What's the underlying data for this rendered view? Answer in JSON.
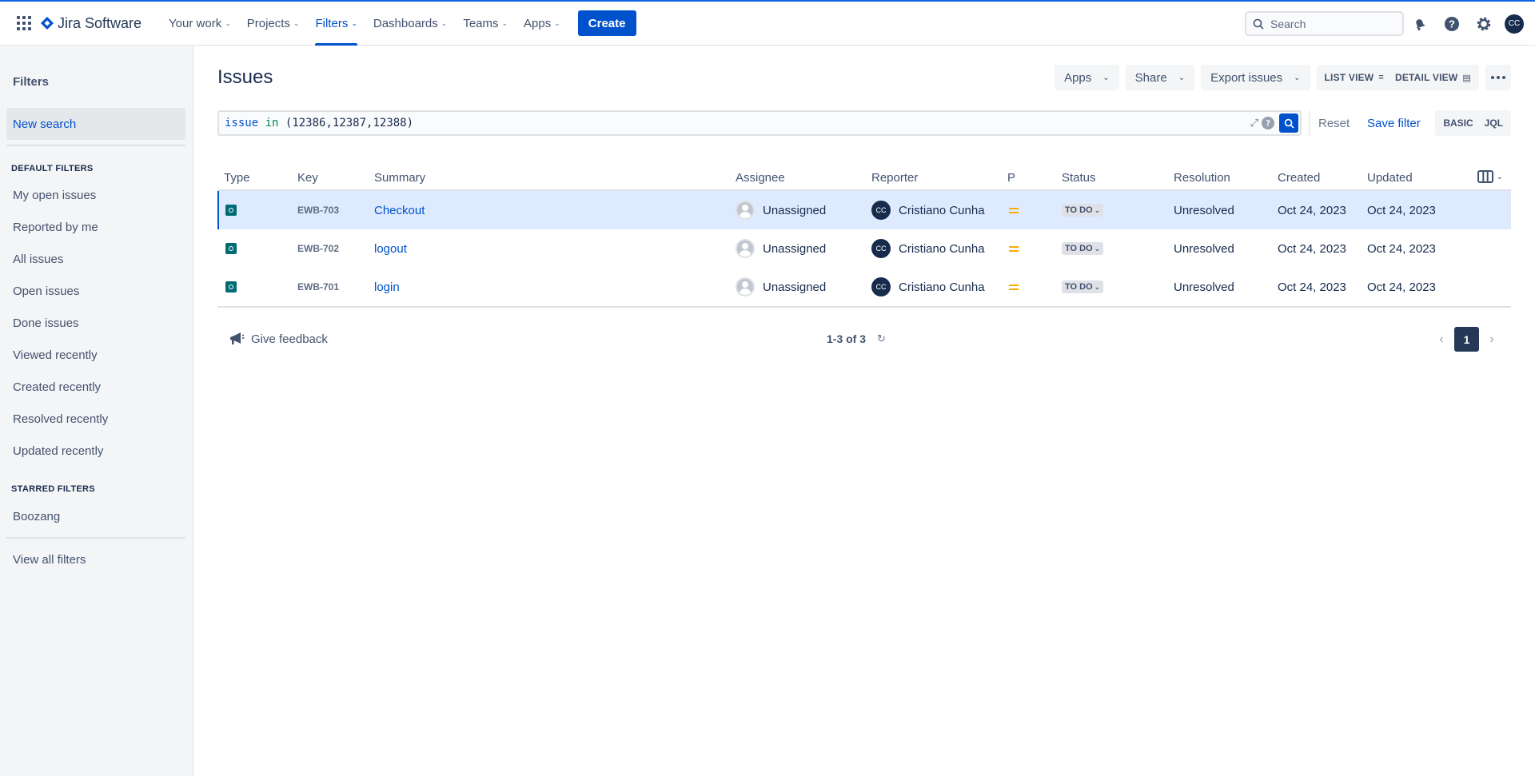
{
  "nav": {
    "product": "Jira Software",
    "items": [
      {
        "label": "Your work"
      },
      {
        "label": "Projects"
      },
      {
        "label": "Filters"
      },
      {
        "label": "Dashboards"
      },
      {
        "label": "Teams"
      },
      {
        "label": "Apps"
      }
    ],
    "create_label": "Create",
    "search_placeholder": "Search",
    "user_initials": "CC"
  },
  "sidebar": {
    "title": "Filters",
    "new_search": "New search",
    "default_heading": "DEFAULT FILTERS",
    "default_items": [
      "My open issues",
      "Reported by me",
      "All issues",
      "Open issues",
      "Done issues",
      "Viewed recently",
      "Created recently",
      "Resolved recently",
      "Updated recently"
    ],
    "starred_heading": "STARRED FILTERS",
    "starred_items": [
      "Boozang"
    ],
    "view_all": "View all filters"
  },
  "main": {
    "title": "Issues",
    "actions": {
      "apps": "Apps",
      "share": "Share",
      "export": "Export issues",
      "list_view": "LIST VIEW",
      "detail_view": "DETAIL VIEW"
    },
    "jql": {
      "field": "issue",
      "operator": "in",
      "value": "(12386,12387,12388)",
      "reset": "Reset",
      "save": "Save filter",
      "basic": "BASIC",
      "jql": "JQL"
    },
    "columns": [
      "Type",
      "Key",
      "Summary",
      "Assignee",
      "Reporter",
      "P",
      "Status",
      "Resolution",
      "Created",
      "Updated"
    ],
    "rows": [
      {
        "key": "EWB-703",
        "summary": "Checkout",
        "assignee": "Unassigned",
        "reporter": "Cristiano Cunha",
        "reporter_initials": "CC",
        "status": "TO DO",
        "resolution": "Unresolved",
        "created": "Oct 24, 2023",
        "updated": "Oct 24, 2023"
      },
      {
        "key": "EWB-702",
        "summary": "logout",
        "assignee": "Unassigned",
        "reporter": "Cristiano Cunha",
        "reporter_initials": "CC",
        "status": "TO DO",
        "resolution": "Unresolved",
        "created": "Oct 24, 2023",
        "updated": "Oct 24, 2023"
      },
      {
        "key": "EWB-701",
        "summary": "login",
        "assignee": "Unassigned",
        "reporter": "Cristiano Cunha",
        "reporter_initials": "CC",
        "status": "TO DO",
        "resolution": "Unresolved",
        "created": "Oct 24, 2023",
        "updated": "Oct 24, 2023"
      }
    ],
    "footer": {
      "feedback": "Give feedback",
      "count": "1-3 of 3",
      "page": "1"
    }
  },
  "colors": {
    "brand": "#0052CC",
    "selected_row": "#DEEBFF",
    "priority_medium": "#FFAB00",
    "story_type": "#006B75"
  }
}
